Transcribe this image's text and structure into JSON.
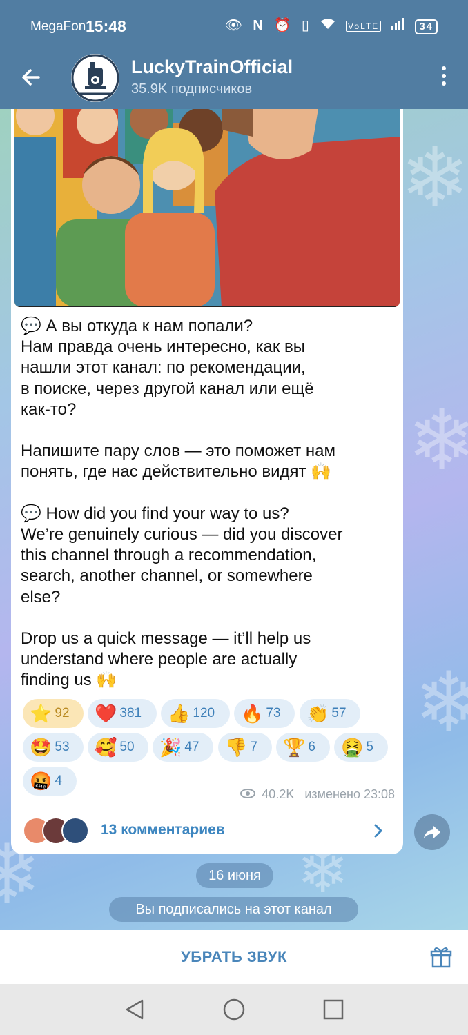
{
  "status": {
    "carrier": "MegaFon",
    "time": "15:48",
    "battery": "34"
  },
  "header": {
    "title": "LuckyTrainOfficial",
    "subtitle": "35.9K подписчиков"
  },
  "message": {
    "text_ru_q": "💬 А вы откуда к нам попали?\nНам правда очень интересно, как вы\nнашли этот канал: по рекомендации,\nв поиске, через другой канал или ещё\nкак-то?\n\nНапишите пару слов — это поможет нам\nпонять, где нас действительно видят 🙌\n\n💬 How did you find your way to us?\nWe’re genuinely curious — did you discover\nthis channel through a recommendation,\nsearch, another channel, or somewhere\nelse?\n\nDrop us a quick message — it’ll help us\nunderstand where people are actually\nfinding us 🙌",
    "views": "40.2K",
    "edited_time": "изменено 23:08",
    "comments_label": "13 комментариев"
  },
  "reactions": [
    {
      "emoji": "⭐",
      "count": "92",
      "selected": true
    },
    {
      "emoji": "❤️",
      "count": "381"
    },
    {
      "emoji": "👍",
      "count": "120"
    },
    {
      "emoji": "🔥",
      "count": "73"
    },
    {
      "emoji": "👏",
      "count": "57"
    },
    {
      "emoji": "🤩",
      "count": "53"
    },
    {
      "emoji": "🥰",
      "count": "50"
    },
    {
      "emoji": "🎉",
      "count": "47"
    },
    {
      "emoji": "👎",
      "count": "7"
    },
    {
      "emoji": "🏆",
      "count": "6"
    },
    {
      "emoji": "🤮",
      "count": "5"
    },
    {
      "emoji": "🤬",
      "count": "4"
    }
  ],
  "date_pill": "16 июня",
  "system_message": "Вы подписались на этот канал",
  "bottom": {
    "mute_label": "УБРАТЬ ЗВУК"
  },
  "icons": {
    "back": "back-arrow-icon",
    "more": "more-vert-icon",
    "views": "eye-icon",
    "share": "share-icon",
    "gift": "gift-icon"
  },
  "colors": {
    "header": "#517da2",
    "accent": "#3d86c0"
  }
}
